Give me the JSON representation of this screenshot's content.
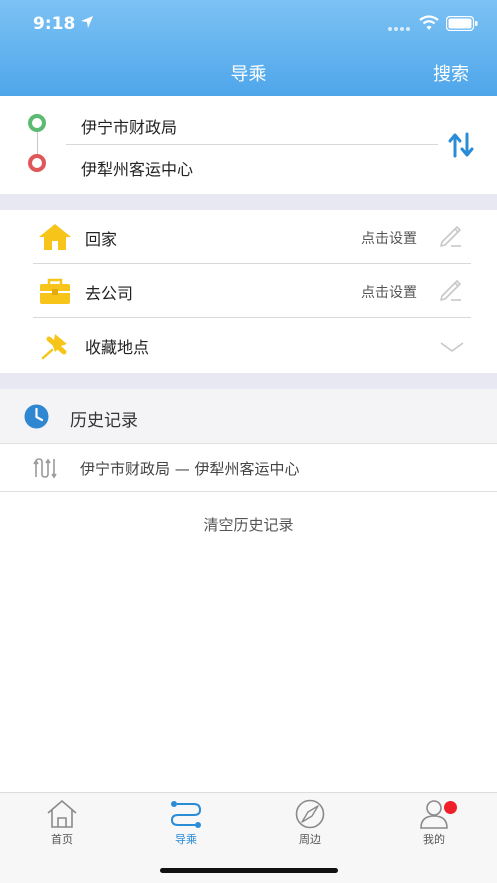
{
  "status_bar": {
    "time": "9:18"
  },
  "nav": {
    "title": "导乘",
    "search_label": "搜索"
  },
  "route": {
    "from": "伊宁市财政局",
    "to": "伊犁州客运中心"
  },
  "places": [
    {
      "label": "回家",
      "hint": "点击设置",
      "icon": "home-icon",
      "color": "#f7c51a"
    },
    {
      "label": "去公司",
      "hint": "点击设置",
      "icon": "briefcase-icon",
      "color": "#f7c51a"
    },
    {
      "label": "收藏地点",
      "icon": "pin-icon",
      "color": "#f7c51a"
    }
  ],
  "history": {
    "title": "历史记录",
    "items": [
      {
        "text": "伊宁市财政局 — 伊犁州客运中心"
      }
    ],
    "clear_label": "清空历史记录"
  },
  "tabs": [
    {
      "label": "首页",
      "icon": "home-outline-icon",
      "active": false
    },
    {
      "label": "导乘",
      "icon": "route-icon",
      "active": true
    },
    {
      "label": "周边",
      "icon": "compass-icon",
      "active": false
    },
    {
      "label": "我的",
      "icon": "user-icon",
      "active": false,
      "badge": true
    }
  ],
  "colors": {
    "header": "#5aaeee",
    "accent": "#2a8bd6",
    "start": "#5cba73",
    "end": "#e0575a",
    "badge": "#f0202a"
  }
}
